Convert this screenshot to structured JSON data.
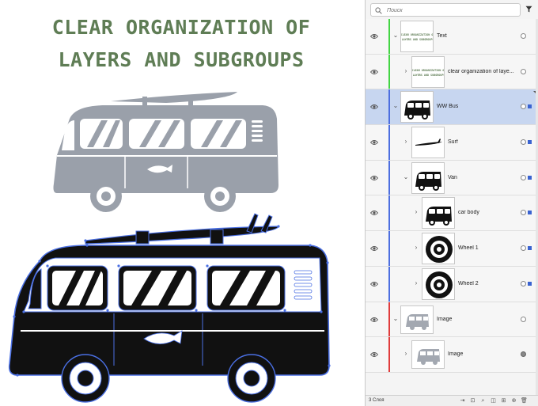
{
  "canvas": {
    "headline_line1": "CLEAR ORGANIZATION OF",
    "headline_line2": "LAYERS AND SUBGROUPS",
    "headline_color": "#5f7d55"
  },
  "layers_panel": {
    "search": {
      "placeholder": "Поиск",
      "value": ""
    },
    "layer_count": "3 Слоя",
    "rows": [
      {
        "name": "Text",
        "color": "#43d543",
        "expanded": true,
        "selected": false,
        "level": 0,
        "thumb": "text"
      },
      {
        "name": "clear organization of laye...",
        "color": "#43d543",
        "expanded": false,
        "selected": false,
        "level": 1,
        "thumb": "text"
      },
      {
        "name": "WW Bus",
        "color": "#4d6fe0",
        "expanded": true,
        "selected": true,
        "level": 0,
        "thumb": "bus"
      },
      {
        "name": "Surf",
        "color": "#4d6fe0",
        "expanded": false,
        "selected": false,
        "level": 1,
        "thumb": "surf"
      },
      {
        "name": "Van",
        "color": "#4d6fe0",
        "expanded": true,
        "selected": false,
        "level": 1,
        "thumb": "bus"
      },
      {
        "name": "car body",
        "color": "#4d6fe0",
        "expanded": false,
        "selected": false,
        "level": 2,
        "thumb": "bus"
      },
      {
        "name": "Wheel 1",
        "color": "#4d6fe0",
        "expanded": false,
        "selected": false,
        "level": 2,
        "thumb": "wheel"
      },
      {
        "name": "Wheel 2",
        "color": "#4d6fe0",
        "expanded": false,
        "selected": false,
        "level": 2,
        "thumb": "wheel"
      },
      {
        "name": "Image",
        "color": "#e03c3c",
        "expanded": true,
        "selected": false,
        "level": 0,
        "thumb": "image"
      },
      {
        "name": "Image",
        "color": "#e03c3c",
        "expanded": false,
        "selected": false,
        "level": 1,
        "thumb": "image"
      }
    ],
    "thumb_text": [
      "CLEAR ORGANIZATION OF",
      "LAYERS AND SUBGROUPS"
    ],
    "selection_color": "#c7d6f0",
    "accent_color": "#3a63d0"
  }
}
